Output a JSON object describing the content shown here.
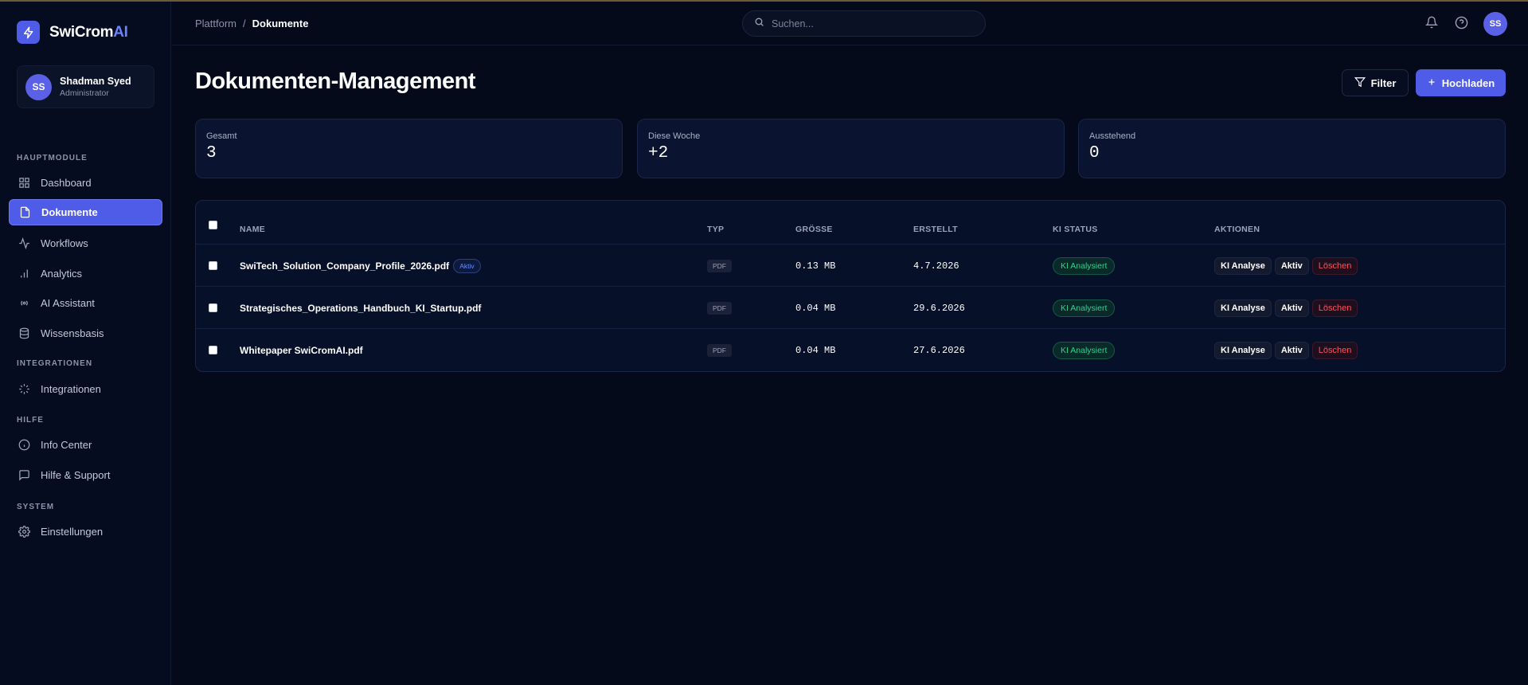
{
  "brand": {
    "name_main": "SwiCrom",
    "name_accent": "AI"
  },
  "user": {
    "initials": "SS",
    "name": "Shadman Syed",
    "role": "Administrator"
  },
  "sidebar": {
    "sections": [
      {
        "title": "HAUPTMODULE"
      },
      {
        "title": "INTEGRATIONEN"
      },
      {
        "title": "HILFE"
      },
      {
        "title": "SYSTEM"
      }
    ],
    "items": [
      {
        "label": "Dashboard",
        "icon": "grid-icon"
      },
      {
        "label": "Dokumente",
        "icon": "document-icon",
        "active": true
      },
      {
        "label": "Workflows",
        "icon": "activity-icon"
      },
      {
        "label": "Analytics",
        "icon": "bar-chart-icon"
      },
      {
        "label": "AI Assistant",
        "icon": "radio-icon"
      },
      {
        "label": "Wissensbasis",
        "icon": "database-icon"
      },
      {
        "label": "Integrationen",
        "icon": "loader-icon"
      },
      {
        "label": "Info Center",
        "icon": "info-icon"
      },
      {
        "label": "Hilfe & Support",
        "icon": "message-icon"
      },
      {
        "label": "Einstellungen",
        "icon": "gear-icon"
      }
    ]
  },
  "header": {
    "breadcrumb": {
      "root": "Plattform",
      "separator": "/",
      "current": "Dokumente"
    },
    "search": {
      "placeholder": "Suchen..."
    },
    "avatar_initials": "SS"
  },
  "page": {
    "title": "Dokumenten-Management",
    "filter_label": "Filter",
    "upload_label": "Hochladen"
  },
  "stats": [
    {
      "label": "Gesamt",
      "value": "3"
    },
    {
      "label": "Diese Woche",
      "value": "+2"
    },
    {
      "label": "Ausstehend",
      "value": "0"
    }
  ],
  "table": {
    "columns": [
      "NAME",
      "TYP",
      "GRÖSSE",
      "ERSTELLT",
      "KI STATUS",
      "AKTIONEN"
    ],
    "rows": [
      {
        "name": "SwiTech_Solution_Company_Profile_2026.pdf",
        "badge": "Aktiv",
        "type": "PDF",
        "size": "0.13 MB",
        "created": "4.7.2026",
        "ki_status": "KI Analysiert",
        "actions": [
          "KI Analyse",
          "Aktiv",
          "Löschen"
        ]
      },
      {
        "name": "Strategisches_Operations_Handbuch_KI_Startup.pdf",
        "badge": "",
        "type": "PDF",
        "size": "0.04 MB",
        "created": "29.6.2026",
        "ki_status": "KI Analysiert",
        "actions": [
          "KI Analyse",
          "Aktiv",
          "Löschen"
        ]
      },
      {
        "name": "Whitepaper SwiCromAI.pdf",
        "badge": "",
        "type": "PDF",
        "size": "0.04 MB",
        "created": "27.6.2026",
        "ki_status": "KI Analysiert",
        "actions": [
          "KI Analyse",
          "Aktiv",
          "Löschen"
        ]
      }
    ]
  },
  "colors": {
    "accent": "#4f5ce8",
    "background": "#040a1a",
    "success": "#2fd08e",
    "danger": "#ff4f5e"
  }
}
